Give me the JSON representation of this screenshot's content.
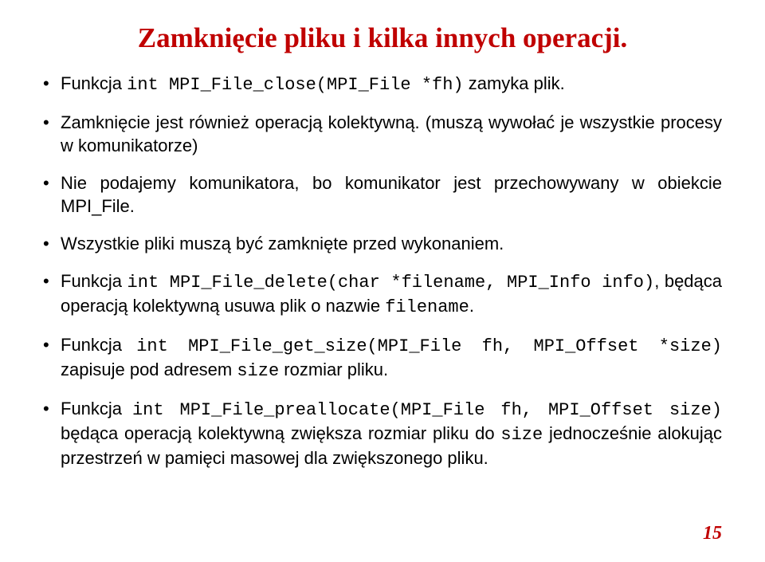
{
  "title": "Zamknięcie pliku i kilka innych operacji.",
  "bullets": {
    "b1": {
      "p1": "Funkcja ",
      "code1": "int MPI_File_close(MPI_File *fh)",
      "p2": " zamyka plik."
    },
    "b2": {
      "p1": "Zamknięcie jest również operacją kolektywną. (muszą wywołać je wszystkie procesy w komunikatorze)"
    },
    "b3": {
      "p1": "Nie podajemy komunikatora, bo komunikator jest przechowywany w obiekcie MPI_File."
    },
    "b4": {
      "p1": "Wszystkie pliki muszą być zamknięte przed wykonaniem."
    },
    "b5": {
      "p1": "Funkcja ",
      "code1": "int MPI_File_delete(char *filename, MPI_Info info)",
      "p2": ", będąca operacją kolektywną usuwa plik o nazwie ",
      "code2": "filename",
      "p3": "."
    },
    "b6": {
      "p1": "Funkcja ",
      "code1": "int MPI_File_get_size(MPI_File fh, MPI_Offset *size)",
      "p2": " zapisuje pod adresem ",
      "code2": "size",
      "p3": " rozmiar pliku."
    },
    "b7": {
      "p1": "Funkcja ",
      "code1": "int MPI_File_preallocate(MPI_File fh, MPI_Offset size)",
      "p2": " będąca operacją kolektywną zwiększa rozmiar pliku do ",
      "code2": "size",
      "p3": " jednocześnie alokując przestrzeń w pamięci masowej dla zwiększonego pliku."
    }
  },
  "page_number": "15"
}
